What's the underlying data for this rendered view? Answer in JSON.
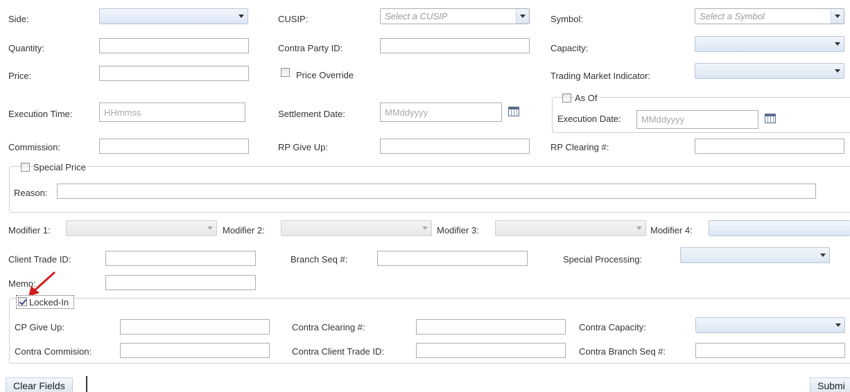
{
  "row1": {
    "side_label": "Side:",
    "cusip_label": "CUSIP:",
    "cusip_placeholder": "Select a CUSIP",
    "symbol_label": "Symbol:",
    "symbol_placeholder": "Select a Symbol"
  },
  "row2": {
    "quantity_label": "Quantity:",
    "contra_party_label": "Contra Party ID:",
    "capacity_label": "Capacity:"
  },
  "row3": {
    "price_label": "Price:",
    "price_override_label": "Price Override",
    "tmi_label": "Trading Market Indicator:"
  },
  "row4": {
    "exec_time_label": "Execution Time:",
    "exec_time_placeholder": "HHmmss",
    "settle_date_label": "Settlement Date:",
    "settle_date_placeholder": "MMddyyyy",
    "as_of_label": "As Of",
    "exec_date_label": "Execution Date:",
    "exec_date_placeholder": "MMddyyyy"
  },
  "row5": {
    "commission_label": "Commission:",
    "rp_give_up_label": "RP Give Up:",
    "rp_clearing_label": "RP Clearing #:"
  },
  "special_price": {
    "label": "Special Price",
    "reason_label": "Reason:"
  },
  "modifiers": {
    "m1": "Modifier 1:",
    "m2": "Modifier 2:",
    "m3": "Modifier 3:",
    "m4": "Modifier 4:"
  },
  "row7": {
    "client_trade_id_label": "Client Trade ID:",
    "branch_seq_label": "Branch Seq #:",
    "special_processing_label": "Special Processing:",
    "memo_label": "Memo:"
  },
  "locked_in": {
    "label": "Locked-In",
    "checked": true,
    "cp_give_up_label": "CP Give Up:",
    "contra_clearing_label": "Contra Clearing #:",
    "contra_capacity_label": "Contra Capacity:",
    "contra_commission_label": "Contra Commision:",
    "contra_client_trade_label": "Contra Client Trade ID:",
    "contra_branch_seq_label": "Contra Branch Seq #:"
  },
  "buttons": {
    "clear_fields": "Clear Fields",
    "submit": "Submi"
  },
  "colors": {
    "annotation_arrow": "#d21e1e"
  }
}
